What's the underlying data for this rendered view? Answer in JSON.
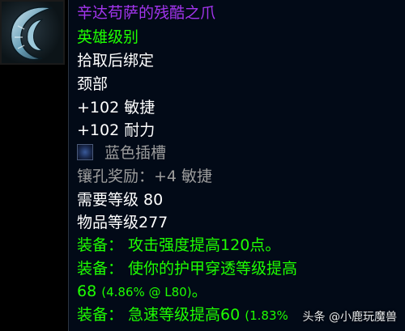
{
  "item": {
    "name": "辛达苟萨的残酷之爪",
    "quality": "英雄级别",
    "binding": "拾取后绑定",
    "slot": "颈部",
    "stat1": "+102 敏捷",
    "stat2": "+102 耐力",
    "socket_label": "蓝色插槽",
    "socket_bonus": "镶孔奖励：+4 敏捷",
    "req_level": "需要等级 80",
    "item_level": "物品等级277",
    "equip1": "装备：  攻击强度提高120点。",
    "equip2_line1": "装备：  使你的护甲穿透等级提高",
    "equip2_line2_main": "68",
    "equip2_line2_small": "(4.86% @ L80)",
    "equip2_line2_end": "。",
    "equip3_main": "装备：  急速等级提高60",
    "equip3_small": "(1.83%"
  },
  "watermark": "头条 @小鹿玩魔兽",
  "icon": "claw-item-icon",
  "colors": {
    "epic": "#a335ee",
    "green": "#1eff00",
    "white": "#ffffff",
    "grey": "#9d9d9d",
    "background": "#020a17"
  }
}
